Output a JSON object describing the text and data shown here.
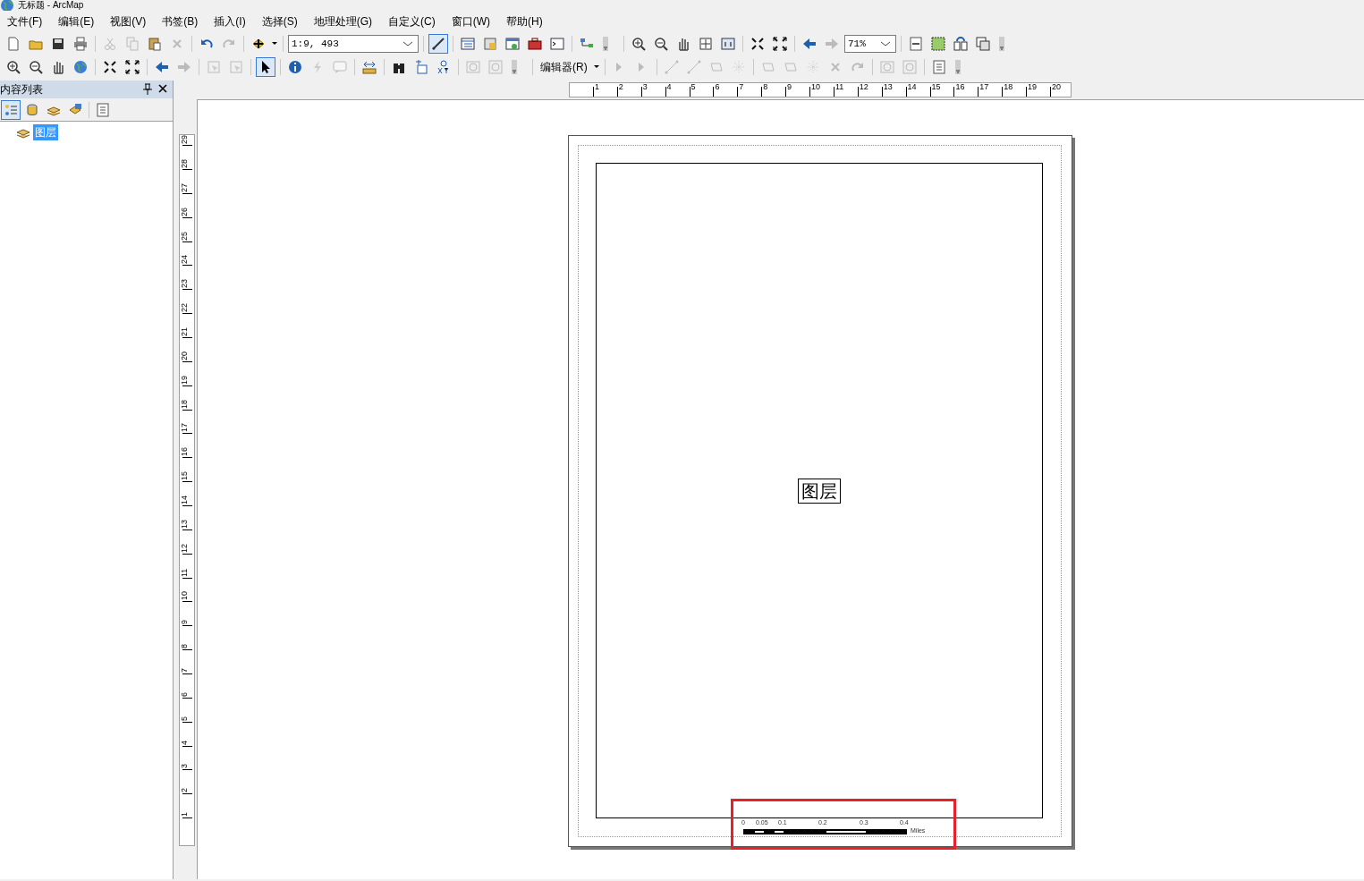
{
  "window": {
    "title": "无标题 - ArcMap"
  },
  "menu": [
    "文件(F)",
    "编辑(E)",
    "视图(V)",
    "书签(B)",
    "插入(I)",
    "选择(S)",
    "地理处理(G)",
    "自定义(C)",
    "窗口(W)",
    "帮助(H)"
  ],
  "toolbar": {
    "scale": "1:9, 493",
    "zoom": "71%",
    "editor_menu": "编辑器(R)"
  },
  "toc": {
    "title": "内容列表",
    "items": [
      {
        "label": "图层",
        "selected": true
      }
    ]
  },
  "rulers": {
    "horizontal": [
      "1",
      "2",
      "3",
      "4",
      "5",
      "6",
      "7",
      "8",
      "9",
      "10",
      "11",
      "12",
      "13",
      "14",
      "15",
      "16",
      "17",
      "18",
      "19",
      "20"
    ],
    "vertical": [
      "1",
      "2",
      "3",
      "4",
      "5",
      "6",
      "7",
      "8",
      "9",
      "10",
      "11",
      "12",
      "13",
      "14",
      "15",
      "16",
      "17",
      "18",
      "19",
      "20",
      "21",
      "22",
      "23",
      "24",
      "25",
      "26",
      "27",
      "28",
      "29"
    ]
  },
  "layout": {
    "data_frame_label": "图层",
    "scale_bar": {
      "labels": [
        "0",
        "0.05",
        "0.1",
        "0.2",
        "0.3",
        "0.4"
      ],
      "units": "Miles"
    },
    "highlight": true
  }
}
